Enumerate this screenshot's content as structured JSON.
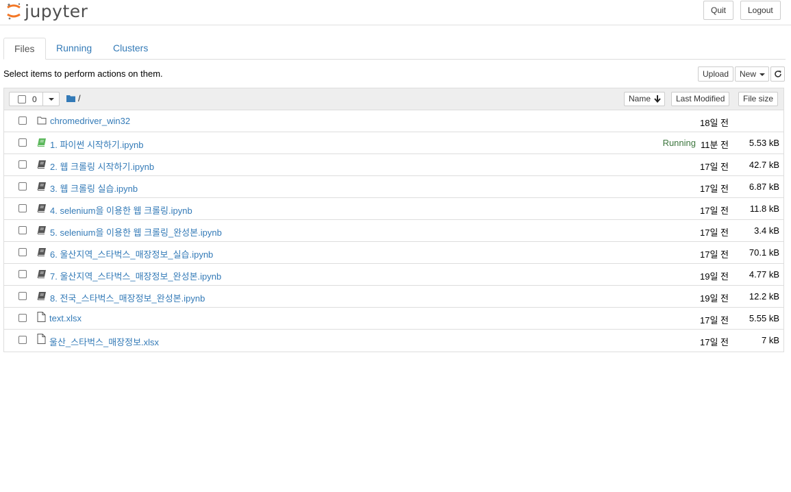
{
  "header": {
    "logo_text": "jupyter",
    "quit_label": "Quit",
    "logout_label": "Logout"
  },
  "tabs": [
    {
      "label": "Files"
    },
    {
      "label": "Running"
    },
    {
      "label": "Clusters"
    }
  ],
  "toolbar": {
    "instructions": "Select items to perform actions on them.",
    "upload_label": "Upload",
    "new_label": "New"
  },
  "list_header": {
    "selected_count": "0",
    "path": "/",
    "name_label": "Name",
    "modified_label": "Last Modified",
    "size_label": "File size"
  },
  "files": [
    {
      "name": "chromedriver_win32",
      "type": "folder",
      "modified": "18일 전",
      "size": "",
      "running": ""
    },
    {
      "name": "1. 파이썬 시작하기.ipynb",
      "type": "notebook-running",
      "modified": "11분 전",
      "size": "5.53 kB",
      "running": "Running"
    },
    {
      "name": "2. 웹 크롤링 시작하기.ipynb",
      "type": "notebook",
      "modified": "17일 전",
      "size": "42.7 kB",
      "running": ""
    },
    {
      "name": "3. 웹 크롤링 실습.ipynb",
      "type": "notebook",
      "modified": "17일 전",
      "size": "6.87 kB",
      "running": ""
    },
    {
      "name": "4. selenium을 이용한 웹 크롤링.ipynb",
      "type": "notebook",
      "modified": "17일 전",
      "size": "11.8 kB",
      "running": ""
    },
    {
      "name": "5. selenium을 이용한 웹 크롤링_완성본.ipynb",
      "type": "notebook",
      "modified": "17일 전",
      "size": "3.4 kB",
      "running": ""
    },
    {
      "name": "6. 울산지역_스타벅스_매장정보_실습.ipynb",
      "type": "notebook",
      "modified": "17일 전",
      "size": "70.1 kB",
      "running": ""
    },
    {
      "name": "7. 울산지역_스타벅스_매장정보_완성본.ipynb",
      "type": "notebook",
      "modified": "19일 전",
      "size": "4.77 kB",
      "running": ""
    },
    {
      "name": "8. 전국_스타벅스_매장정보_완성본.ipynb",
      "type": "notebook",
      "modified": "19일 전",
      "size": "12.2 kB",
      "running": ""
    },
    {
      "name": "text.xlsx",
      "type": "file",
      "modified": "17일 전",
      "size": "5.55 kB",
      "running": ""
    },
    {
      "name": "울산_스타벅스_매장정보.xlsx",
      "type": "file",
      "modified": "17일 전",
      "size": "7 kB",
      "running": ""
    }
  ],
  "colors": {
    "link": "#337ab7",
    "running": "#3c763d",
    "logo_orange": "#f37726"
  }
}
